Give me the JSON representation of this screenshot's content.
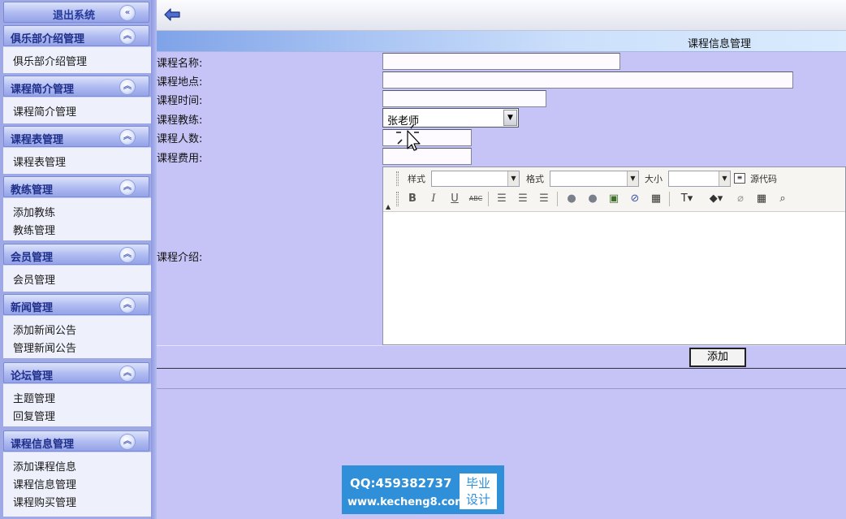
{
  "sidebar": {
    "logout": "退出系统",
    "groups": [
      {
        "title": "俱乐部介绍管理",
        "items": [
          "俱乐部介绍管理"
        ]
      },
      {
        "title": "课程简介管理",
        "items": [
          "课程简介管理"
        ]
      },
      {
        "title": "课程表管理",
        "items": [
          "课程表管理"
        ]
      },
      {
        "title": "教练管理",
        "items": [
          "添加教练",
          "教练管理"
        ]
      },
      {
        "title": "会员管理",
        "items": [
          "会员管理"
        ]
      },
      {
        "title": "新闻管理",
        "items": [
          "添加新闻公告",
          "管理新闻公告"
        ]
      },
      {
        "title": "论坛管理",
        "items": [
          "主题管理",
          "回复管理"
        ]
      },
      {
        "title": "课程信息管理",
        "items": [
          "添加课程信息",
          "课程信息管理",
          "课程购买管理"
        ]
      }
    ],
    "icons": {
      "collapse": "double-chevron-icon"
    }
  },
  "topbar": {
    "back_icon": "back-arrow-icon"
  },
  "page": {
    "title": "课程信息管理",
    "form": {
      "name_label": "课程名称:",
      "name_value": "",
      "location_label": "课程地点:",
      "location_value": "",
      "time_label": "课程时间:",
      "time_value": "",
      "coach_label": "课程教练:",
      "coach_value": "张老师",
      "capacity_label": "课程人数:",
      "capacity_value": "",
      "fee_label": "课程费用:",
      "fee_value": "",
      "intro_label": "课程介绍:"
    },
    "editor": {
      "style_label": "样式",
      "format_label": "格式",
      "size_label": "大小",
      "source_label": "源代码",
      "bold": "B",
      "italic": "I",
      "underline": "U",
      "strike": "ABC"
    },
    "submit_label": "添加"
  },
  "watermark": {
    "qq": "QQ:459382737",
    "site": "www.kecheng8.com",
    "badge_line1": "毕业",
    "badge_line2": "设计"
  },
  "colors": {
    "content_bg": "#c6c4f6",
    "sidebar_header_text": "#1f2f8a",
    "title_bar_start": "#7fa3e8",
    "watermark_bg": "#2f8fd8"
  }
}
